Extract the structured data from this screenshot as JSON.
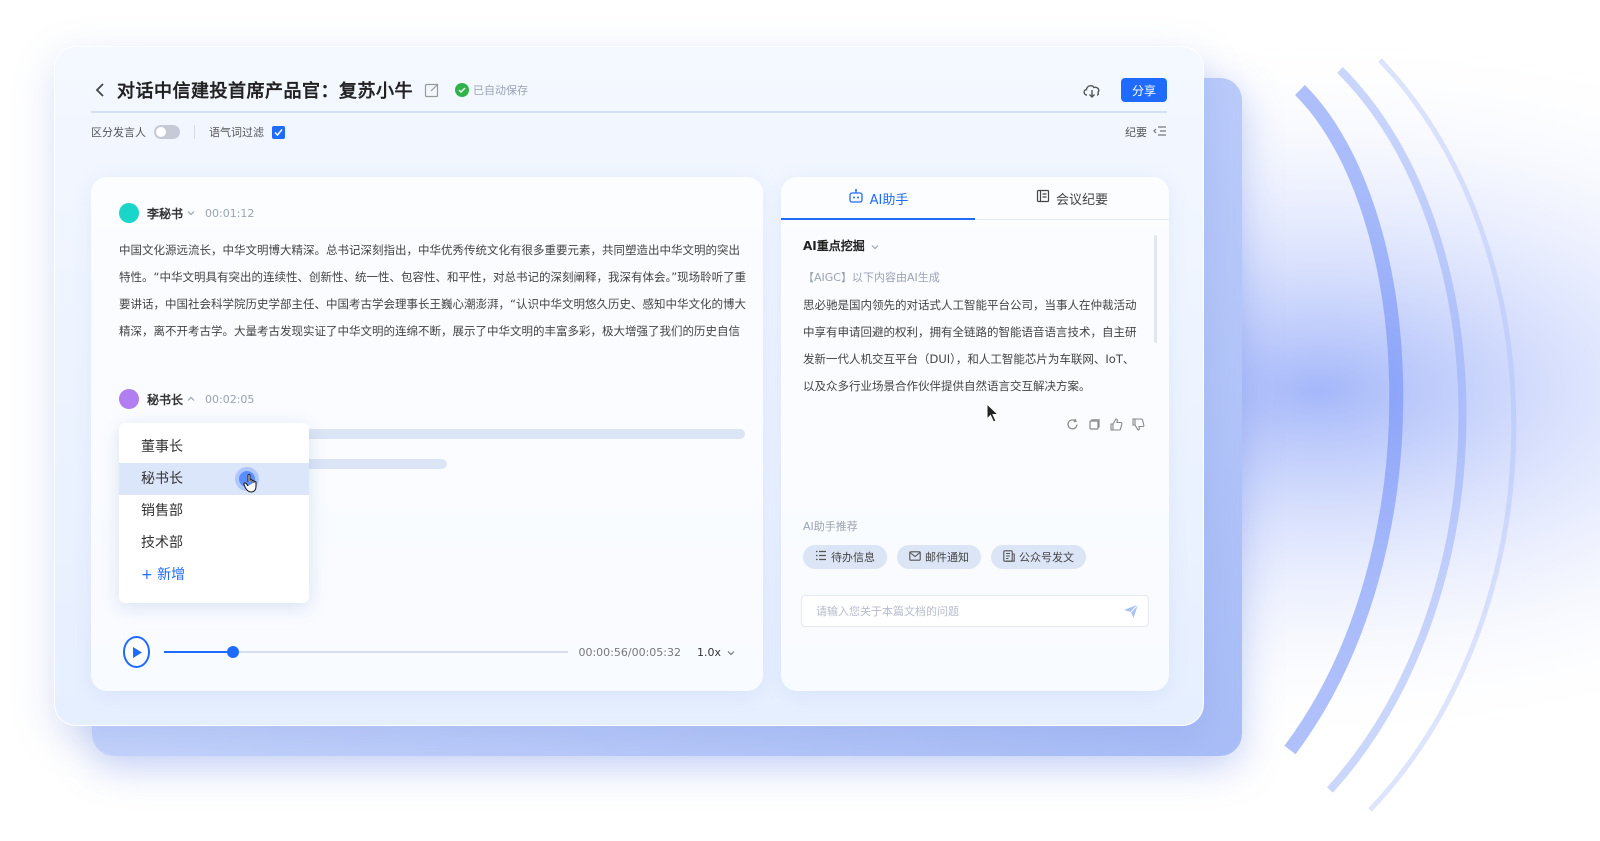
{
  "header": {
    "title": "对话中信建投首席产品官：复苏小牛",
    "saved_status": "已自动保存",
    "share_label": "分享"
  },
  "toolbar": {
    "speaker_toggle_label": "区分发言人",
    "filter_label": "语气词过滤",
    "summary_label": "纪要"
  },
  "transcript": {
    "blocks": [
      {
        "speaker": "李秘书",
        "time": "00:01:12",
        "avatar_color": "#19d6c8",
        "text": "中国文化源远流长，中华文明博大精深。总书记深刻指出，中华优秀传统文化有很多重要元素，共同塑造出中华文明的突出特性。“中华文明具有突出的连续性、创新性、统一性、包容性、和平性，对总书记的深刻阐释，我深有体会。”现场聆听了重要讲话，中国社会科学院历史学部主任、中国考古学会理事长王巍心潮澎湃，“认识中华文明悠久历史、感知中华文化的博大精深，离不开考古学。大量考古发现实证了中华文明的连绵不断，展示了中华文明的丰富多彩，极大增强了我们的历史自信"
      },
      {
        "speaker": "秘书长",
        "time": "00:02:05",
        "avatar_color": "#b07ef0"
      }
    ]
  },
  "speaker_dropdown": {
    "options": [
      "董事长",
      "秘书长",
      "销售部",
      "技术部"
    ],
    "selected": "秘书长",
    "add_label": "+ 新增"
  },
  "player": {
    "time_display": "00:00:56/00:05:32",
    "progress": 0.1687,
    "speed": "1.0x"
  },
  "right_panel": {
    "tabs": [
      {
        "label": "AI助手",
        "active": true
      },
      {
        "label": "会议纪要",
        "active": false
      }
    ],
    "section_title": "AI重点挖掘",
    "aigc_note": "【AIGC】以下内容由AI生成",
    "ai_content": "思必驰是国内领先的对话式人工智能平台公司，当事人在仲裁活动中享有申请回避的权利，拥有全链路的智能语音语言技术，自主研发新一代人机交互平台（DUI），和人工智能芯片为车联网、IoT、以及众多行业场景合作伙伴提供自然语言交互解决方案。",
    "recommend_title": "AI助手推荐",
    "chips": [
      {
        "label": "待办信息",
        "icon": "list-icon"
      },
      {
        "label": "邮件通知",
        "icon": "mail-icon"
      },
      {
        "label": "公众号发文",
        "icon": "article-icon"
      }
    ],
    "input_placeholder": "请输入您关于本篇文档的问题"
  },
  "colors": {
    "accent": "#1f6bff",
    "success": "#2fb34a"
  }
}
